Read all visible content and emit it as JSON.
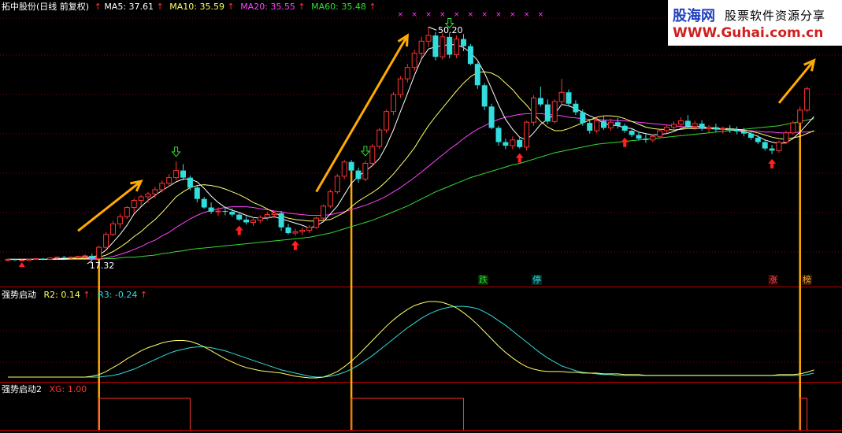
{
  "header": {
    "stock_label": "拓中股份(日线 前复权)",
    "ma_items": [
      {
        "label": "MA5: 37.61",
        "color": "#ffffff"
      },
      {
        "label": "MA10: 35.59",
        "color": "#ffff66"
      },
      {
        "label": "MA20: 35.55",
        "color": "#ff44ff"
      },
      {
        "label": "MA60: 35.48",
        "color": "#33dd33"
      }
    ]
  },
  "watermark": {
    "line1": "股海网",
    "line1b": "股票软件资源分享",
    "line2": "WWW.Guhai.com.cn"
  },
  "price_panel": {
    "high_label": "50.20",
    "low_label": "17.32",
    "tags": [
      {
        "text": "跌",
        "color": "#33dd33",
        "bg": "#003300"
      },
      {
        "text": "停",
        "color": "#33dddd",
        "bg": "#003333"
      },
      {
        "text": "涨",
        "color": "#ff5555",
        "bg": "#330000"
      },
      {
        "text": "榜",
        "color": "#ffaa33",
        "bg": "#331a00"
      }
    ]
  },
  "ind1": {
    "label": "强势启动",
    "r2_label": "R2: 0.14",
    "r3_label": "R3: -0.24",
    "r2_color": "#ffff66",
    "r3_color": "#33dddd"
  },
  "ind2": {
    "label": "强势启动2",
    "xg_label": "XG: 1.00",
    "xg_color": "#ff3333"
  },
  "chart_data": {
    "type": "line",
    "candles": [
      [
        17.4,
        17.6,
        17.2,
        17.5
      ],
      [
        17.5,
        17.6,
        17.3,
        17.4
      ],
      [
        17.4,
        17.5,
        17.3,
        17.4
      ],
      [
        17.4,
        17.6,
        17.3,
        17.5
      ],
      [
        17.5,
        17.7,
        17.4,
        17.6
      ],
      [
        17.6,
        17.7,
        17.4,
        17.5
      ],
      [
        17.5,
        17.8,
        17.4,
        17.7
      ],
      [
        17.7,
        17.9,
        17.5,
        17.8
      ],
      [
        17.8,
        18.0,
        17.6,
        17.7
      ],
      [
        17.7,
        17.9,
        17.5,
        17.8
      ],
      [
        17.8,
        18.0,
        17.6,
        17.9
      ],
      [
        17.9,
        18.2,
        17.7,
        18.0
      ],
      [
        18.0,
        18.3,
        17.32,
        17.6
      ],
      [
        17.6,
        19.4,
        17.5,
        19.2
      ],
      [
        19.2,
        21.3,
        19.0,
        21.0
      ],
      [
        21.0,
        22.9,
        20.8,
        22.5
      ],
      [
        22.5,
        23.9,
        21.9,
        23.5
      ],
      [
        23.5,
        25.0,
        23.2,
        24.8
      ],
      [
        24.8,
        26.1,
        24.0,
        25.8
      ],
      [
        25.8,
        26.6,
        25.0,
        26.3
      ],
      [
        26.3,
        27.0,
        25.5,
        26.7
      ],
      [
        26.7,
        27.7,
        26.1,
        27.3
      ],
      [
        27.3,
        28.6,
        26.9,
        28.2
      ],
      [
        28.2,
        29.5,
        27.7,
        29.0
      ],
      [
        29.0,
        31.3,
        28.6,
        30.0
      ],
      [
        30.0,
        30.9,
        28.6,
        29.0
      ],
      [
        29.0,
        29.3,
        27.2,
        27.6
      ],
      [
        27.6,
        27.9,
        25.5,
        26.0
      ],
      [
        26.0,
        26.3,
        24.6,
        24.8
      ],
      [
        24.8,
        25.5,
        23.9,
        24.2
      ],
      [
        24.2,
        24.8,
        23.6,
        24.3
      ],
      [
        24.3,
        24.9,
        23.7,
        24.2
      ],
      [
        24.2,
        24.7,
        23.5,
        23.8
      ],
      [
        23.8,
        24.2,
        22.9,
        23.1
      ],
      [
        23.1,
        23.6,
        22.4,
        22.7
      ],
      [
        22.7,
        23.4,
        22.2,
        23.0
      ],
      [
        23.0,
        23.7,
        22.6,
        23.4
      ],
      [
        23.4,
        24.2,
        23.0,
        23.8
      ],
      [
        23.8,
        24.3,
        23.3,
        24.0
      ],
      [
        24.0,
        24.3,
        21.5,
        22.0
      ],
      [
        22.0,
        22.5,
        21.0,
        21.2
      ],
      [
        21.2,
        21.8,
        20.8,
        21.4
      ],
      [
        21.4,
        22.0,
        20.9,
        21.6
      ],
      [
        21.6,
        22.3,
        21.2,
        22.0
      ],
      [
        22.0,
        23.5,
        21.8,
        23.3
      ],
      [
        23.3,
        25.2,
        23.0,
        25.0
      ],
      [
        25.0,
        27.3,
        24.7,
        27.0
      ],
      [
        27.0,
        29.5,
        26.7,
        29.2
      ],
      [
        29.2,
        31.5,
        28.8,
        31.2
      ],
      [
        31.2,
        31.5,
        29.5,
        30.0
      ],
      [
        30.0,
        30.4,
        28.3,
        28.8
      ],
      [
        28.8,
        31.4,
        28.5,
        31.0
      ],
      [
        31.0,
        33.7,
        30.7,
        33.4
      ],
      [
        33.4,
        36.0,
        33.0,
        35.7
      ],
      [
        35.7,
        38.6,
        35.3,
        38.3
      ],
      [
        38.3,
        41.0,
        37.8,
        40.7
      ],
      [
        40.7,
        43.3,
        40.2,
        42.9
      ],
      [
        42.9,
        45.0,
        42.4,
        44.5
      ],
      [
        44.5,
        47.0,
        44.0,
        46.5
      ],
      [
        46.5,
        48.8,
        45.8,
        48.2
      ],
      [
        48.2,
        50.2,
        47.4,
        49.0
      ],
      [
        49.0,
        49.5,
        45.5,
        46.0
      ],
      [
        46.0,
        49.3,
        45.6,
        48.8
      ],
      [
        48.8,
        49.4,
        45.8,
        46.3
      ],
      [
        46.3,
        49.0,
        45.8,
        48.5
      ],
      [
        48.5,
        49.2,
        46.8,
        47.5
      ],
      [
        47.5,
        47.8,
        44.8,
        45.0
      ],
      [
        45.0,
        45.2,
        41.5,
        42.0
      ],
      [
        42.0,
        42.3,
        38.5,
        39.0
      ],
      [
        39.0,
        39.4,
        35.8,
        36.0
      ],
      [
        36.0,
        36.3,
        33.5,
        34.0
      ],
      [
        34.0,
        34.5,
        33.0,
        33.5
      ],
      [
        33.5,
        34.8,
        33.0,
        34.3
      ],
      [
        34.3,
        34.6,
        33.1,
        33.3
      ],
      [
        33.3,
        37.0,
        32.8,
        36.8
      ],
      [
        36.8,
        40.6,
        36.3,
        40.2
      ],
      [
        40.2,
        41.8,
        39.0,
        39.3
      ],
      [
        39.3,
        40.0,
        36.5,
        36.9
      ],
      [
        36.9,
        40.0,
        36.6,
        39.7
      ],
      [
        39.7,
        42.9,
        39.2,
        41.0
      ],
      [
        41.0,
        41.4,
        39.0,
        39.4
      ],
      [
        39.4,
        39.9,
        37.8,
        38.2
      ],
      [
        38.2,
        38.6,
        36.3,
        36.7
      ],
      [
        36.7,
        37.2,
        35.2,
        35.6
      ],
      [
        35.6,
        37.4,
        35.3,
        37.0
      ],
      [
        37.0,
        37.6,
        35.7,
        36.0
      ],
      [
        36.0,
        37.3,
        35.6,
        36.8
      ],
      [
        36.8,
        37.4,
        35.9,
        36.3
      ],
      [
        36.3,
        36.6,
        35.3,
        35.6
      ],
      [
        35.6,
        35.9,
        34.7,
        35.0
      ],
      [
        35.0,
        35.5,
        34.2,
        34.5
      ],
      [
        34.5,
        35.1,
        33.9,
        34.3
      ],
      [
        34.3,
        35.0,
        34.0,
        34.8
      ],
      [
        34.8,
        35.8,
        34.5,
        35.6
      ],
      [
        35.6,
        36.5,
        35.2,
        36.1
      ],
      [
        36.1,
        36.9,
        35.6,
        36.5
      ],
      [
        36.5,
        37.5,
        36.0,
        37.0
      ],
      [
        37.0,
        37.8,
        35.9,
        36.2
      ],
      [
        36.2,
        37.0,
        35.7,
        36.6
      ],
      [
        36.6,
        37.1,
        35.6,
        35.9
      ],
      [
        35.9,
        36.4,
        35.3,
        36.1
      ],
      [
        36.1,
        36.6,
        35.4,
        35.8
      ],
      [
        35.8,
        36.2,
        35.2,
        35.9
      ],
      [
        35.9,
        36.4,
        35.3,
        35.7
      ],
      [
        35.7,
        36.2,
        35.1,
        35.5
      ],
      [
        35.5,
        36.0,
        34.8,
        35.2
      ],
      [
        35.2,
        35.6,
        34.3,
        34.6
      ],
      [
        34.6,
        35.0,
        33.7,
        34.0
      ],
      [
        34.0,
        34.4,
        32.8,
        33.1
      ],
      [
        33.1,
        33.6,
        32.3,
        32.8
      ],
      [
        32.8,
        34.2,
        32.5,
        34.0
      ],
      [
        34.0,
        35.6,
        33.7,
        35.3
      ],
      [
        35.3,
        37.0,
        35.0,
        36.7
      ],
      [
        36.7,
        39.0,
        36.3,
        38.5
      ],
      [
        38.5,
        41.8,
        38.2,
        41.5
      ]
    ],
    "ma5": [
      17.5,
      17.5,
      17.5,
      17.5,
      17.5,
      17.5,
      17.5,
      17.6,
      17.6,
      17.7,
      17.8,
      17.8,
      17.8,
      18.1,
      18.8,
      19.9,
      21.0,
      22.3,
      23.9,
      24.9,
      25.8,
      26.5,
      27.2,
      27.8,
      28.4,
      28.8,
      28.8,
      28.4,
      27.5,
      26.4,
      25.5,
      24.8,
      24.4,
      24.1,
      23.7,
      23.4,
      23.3,
      23.3,
      23.5,
      23.2,
      22.9,
      22.6,
      22.3,
      21.9,
      22.2,
      22.8,
      23.9,
      25.0,
      26.6,
      28.2,
      29.2,
      29.9,
      30.7,
      31.7,
      33.5,
      35.7,
      38.3,
      40.8,
      43.4,
      45.7,
      47.1,
      47.4,
      47.6,
      47.7,
      47.7,
      47.3,
      46.6,
      45.5,
      43.7,
      41.5,
      39.2,
      37.2,
      35.8,
      34.7,
      34.3,
      35.3,
      36.5,
      37.2,
      37.9,
      39.3,
      39.1,
      38.7,
      38.2,
      37.7,
      37.3,
      36.6,
      36.4,
      36.3,
      36.0,
      35.9,
      35.4,
      35.2,
      35.0,
      35.1,
      35.2,
      35.5,
      35.9,
      36.2,
      36.2,
      36.2,
      36.0,
      36.0,
      35.8,
      35.8,
      35.6,
      35.5,
      35.2,
      34.8,
      34.3,
      34.0,
      33.8,
      33.9,
      34.5,
      35.4,
      36.5,
      37.6
    ],
    "ma10": [
      17.5,
      17.5,
      17.5,
      17.5,
      17.5,
      17.5,
      17.5,
      17.5,
      17.5,
      17.6,
      17.6,
      17.6,
      17.7,
      17.8,
      18.1,
      18.6,
      19.2,
      19.9,
      20.7,
      21.4,
      22.3,
      23.1,
      24.1,
      25.2,
      26.3,
      27.0,
      27.6,
      27.9,
      28.0,
      27.9,
      27.7,
      27.4,
      27.0,
      26.6,
      26.1,
      25.5,
      25.1,
      24.6,
      24.1,
      23.6,
      23.3,
      23.1,
      23.0,
      22.9,
      22.9,
      23.0,
      23.1,
      23.6,
      24.1,
      24.9,
      25.7,
      26.3,
      26.9,
      27.6,
      28.5,
      29.5,
      30.7,
      31.9,
      33.2,
      34.8,
      36.3,
      37.6,
      38.8,
      40.0,
      41.2,
      42.3,
      43.2,
      43.8,
      43.9,
      43.7,
      43.2,
      42.3,
      41.4,
      40.2,
      39.2,
      38.0,
      36.9,
      36.1,
      35.6,
      35.6,
      35.9,
      36.3,
      36.7,
      37.1,
      37.5,
      37.7,
      37.7,
      37.6,
      37.3,
      36.9,
      36.5,
      36.1,
      35.9,
      35.8,
      35.8,
      35.7,
      35.8,
      35.9,
      35.9,
      36.0,
      35.9,
      35.9,
      35.9,
      35.9,
      35.8,
      35.7,
      35.5,
      35.3,
      35.0,
      34.7,
      34.5,
      34.4,
      34.6,
      34.8,
      35.2,
      35.6
    ],
    "ma20": [
      17.5,
      17.5,
      17.5,
      17.5,
      17.5,
      17.5,
      17.5,
      17.5,
      17.5,
      17.5,
      17.6,
      17.6,
      17.6,
      17.6,
      17.7,
      17.9,
      18.2,
      18.5,
      18.9,
      19.3,
      19.8,
      20.2,
      20.8,
      21.3,
      22.0,
      22.6,
      23.2,
      23.7,
      24.1,
      24.4,
      24.6,
      24.8,
      24.9,
      24.9,
      24.9,
      24.8,
      24.6,
      24.5,
      24.3,
      24.2,
      24.0,
      23.9,
      23.8,
      23.7,
      23.7,
      23.7,
      23.8,
      24.0,
      24.2,
      24.5,
      24.8,
      25.1,
      25.5,
      25.9,
      26.4,
      27.0,
      27.6,
      28.3,
      29.0,
      29.8,
      30.6,
      31.4,
      32.2,
      33.0,
      33.7,
      34.5,
      35.2,
      35.8,
      36.3,
      36.8,
      37.2,
      37.5,
      37.7,
      37.9,
      38.0,
      38.0,
      38.0,
      37.9,
      37.8,
      37.7,
      37.5,
      37.4,
      37.3,
      37.2,
      37.2,
      37.1,
      37.1,
      37.0,
      37.0,
      36.9,
      36.8,
      36.7,
      36.6,
      36.5,
      36.4,
      36.3,
      36.2,
      36.1,
      36.0,
      35.9,
      35.9,
      35.8,
      35.8,
      35.7,
      35.7,
      35.6,
      35.6,
      35.5,
      35.4,
      35.4,
      35.3,
      35.3,
      35.3,
      35.4,
      35.4,
      35.5
    ],
    "ma60": [
      17.5,
      17.5,
      17.5,
      17.5,
      17.5,
      17.5,
      17.5,
      17.5,
      17.5,
      17.5,
      17.5,
      17.5,
      17.5,
      17.5,
      17.6,
      17.6,
      17.7,
      17.8,
      17.8,
      17.9,
      18.0,
      18.1,
      18.3,
      18.4,
      18.6,
      18.7,
      18.9,
      19.0,
      19.1,
      19.2,
      19.3,
      19.4,
      19.5,
      19.6,
      19.7,
      19.8,
      19.9,
      20.0,
      20.1,
      20.2,
      20.3,
      20.4,
      20.5,
      20.6,
      20.8,
      21.0,
      21.2,
      21.5,
      21.8,
      22.1,
      22.4,
      22.7,
      23.0,
      23.4,
      23.8,
      24.2,
      24.6,
      25.0,
      25.5,
      26.0,
      26.5,
      27.0,
      27.4,
      27.8,
      28.2,
      28.6,
      29.0,
      29.3,
      29.6,
      29.9,
      30.2,
      30.5,
      30.8,
      31.0,
      31.3,
      31.6,
      31.9,
      32.2,
      32.5,
      32.7,
      32.9,
      33.1,
      33.3,
      33.5,
      33.7,
      33.8,
      33.9,
      34.0,
      34.1,
      34.2,
      34.3,
      34.4,
      34.5,
      34.6,
      34.7,
      34.8,
      34.9,
      35.0,
      35.1,
      35.2,
      35.3,
      35.4,
      35.5,
      35.6,
      35.7,
      35.8,
      35.9,
      36.0,
      36.1,
      36.2,
      36.3,
      36.5,
      36.7,
      36.9,
      37.1,
      37.3
    ],
    "r2": [
      0.05,
      0.05,
      0.05,
      0.05,
      0.05,
      0.05,
      0.05,
      0.05,
      0.05,
      0.05,
      0.05,
      0.05,
      0.06,
      0.08,
      0.12,
      0.17,
      0.22,
      0.28,
      0.33,
      0.38,
      0.42,
      0.45,
      0.48,
      0.5,
      0.51,
      0.51,
      0.5,
      0.47,
      0.43,
      0.38,
      0.33,
      0.28,
      0.24,
      0.2,
      0.17,
      0.15,
      0.13,
      0.12,
      0.11,
      0.1,
      0.08,
      0.06,
      0.05,
      0.04,
      0.04,
      0.05,
      0.08,
      0.12,
      0.18,
      0.25,
      0.33,
      0.42,
      0.51,
      0.6,
      0.69,
      0.77,
      0.84,
      0.9,
      0.95,
      0.98,
      1.0,
      1.0,
      0.99,
      0.96,
      0.92,
      0.86,
      0.79,
      0.71,
      0.62,
      0.53,
      0.44,
      0.36,
      0.29,
      0.23,
      0.18,
      0.15,
      0.13,
      0.12,
      0.12,
      0.12,
      0.11,
      0.11,
      0.1,
      0.1,
      0.1,
      0.09,
      0.09,
      0.09,
      0.08,
      0.08,
      0.08,
      0.07,
      0.07,
      0.07,
      0.07,
      0.07,
      0.07,
      0.07,
      0.07,
      0.07,
      0.07,
      0.07,
      0.07,
      0.07,
      0.07,
      0.07,
      0.07,
      0.07,
      0.07,
      0.07,
      0.08,
      0.08,
      0.08,
      0.09,
      0.11,
      0.14
    ],
    "r3": [
      0.05,
      0.05,
      0.05,
      0.05,
      0.05,
      0.05,
      0.05,
      0.05,
      0.05,
      0.05,
      0.05,
      0.05,
      0.05,
      0.05,
      0.06,
      0.07,
      0.09,
      0.12,
      0.15,
      0.19,
      0.23,
      0.27,
      0.31,
      0.35,
      0.38,
      0.4,
      0.42,
      0.43,
      0.43,
      0.42,
      0.4,
      0.38,
      0.35,
      0.32,
      0.29,
      0.26,
      0.23,
      0.2,
      0.17,
      0.14,
      0.12,
      0.1,
      0.08,
      0.06,
      0.05,
      0.05,
      0.06,
      0.08,
      0.11,
      0.15,
      0.2,
      0.26,
      0.32,
      0.39,
      0.46,
      0.53,
      0.6,
      0.67,
      0.73,
      0.79,
      0.84,
      0.88,
      0.91,
      0.93,
      0.94,
      0.94,
      0.93,
      0.91,
      0.87,
      0.82,
      0.76,
      0.7,
      0.63,
      0.56,
      0.49,
      0.42,
      0.35,
      0.29,
      0.24,
      0.19,
      0.16,
      0.13,
      0.11,
      0.1,
      0.09,
      0.08,
      0.08,
      0.07,
      0.07,
      0.07,
      0.07,
      0.07,
      0.07,
      0.07,
      0.07,
      0.07,
      0.07,
      0.07,
      0.07,
      0.07,
      0.07,
      0.07,
      0.07,
      0.07,
      0.07,
      0.07,
      0.07,
      0.07,
      0.07,
      0.07,
      0.07,
      0.07,
      0.07,
      0.07,
      0.08,
      0.1
    ],
    "xg_start_indices": [
      13,
      49,
      113
    ],
    "xg_end_indices": [
      26,
      65,
      114
    ],
    "buy_arrow_indices": [
      33,
      41,
      73,
      88,
      109
    ],
    "sell_arrow_indices": [
      24,
      51,
      63
    ]
  }
}
